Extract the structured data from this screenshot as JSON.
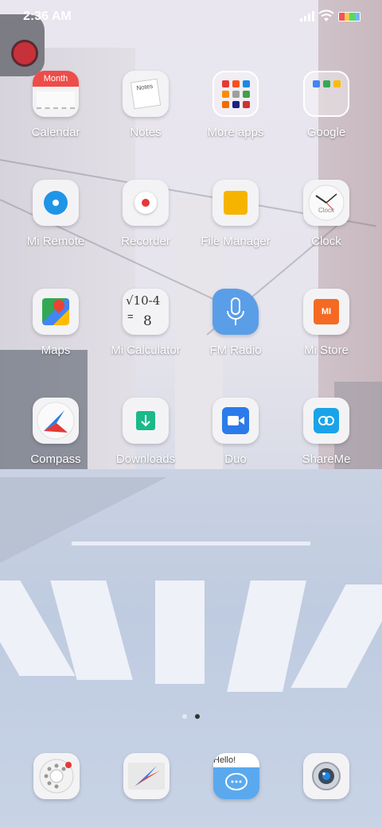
{
  "status_bar": {
    "time": "2:36 AM",
    "icons": [
      "signal-icon",
      "wifi-icon",
      "battery-icon"
    ]
  },
  "apps": [
    {
      "label": "Calendar",
      "icon": "calendar-icon",
      "icon_text": "Month"
    },
    {
      "label": "Notes",
      "icon": "notes-icon",
      "icon_text": "Notes"
    },
    {
      "label": "More apps",
      "icon": "folder-icon"
    },
    {
      "label": "Google",
      "icon": "folder-icon"
    },
    {
      "label": "Mi Remote",
      "icon": "remote-icon"
    },
    {
      "label": "Recorder",
      "icon": "recorder-icon"
    },
    {
      "label": "File Manager",
      "icon": "file-manager-icon"
    },
    {
      "label": "Clock",
      "icon": "clock-icon",
      "icon_text": "Clock"
    },
    {
      "label": "Maps",
      "icon": "maps-icon"
    },
    {
      "label": "Mi Calculator",
      "icon": "calculator-icon",
      "icon_text_top": "√10-4",
      "icon_text_bottom": "8",
      "icon_text_eq": "="
    },
    {
      "label": "FM Radio",
      "icon": "microphone-icon"
    },
    {
      "label": "Mi Store",
      "icon": "mi-store-icon",
      "icon_text": "MI"
    },
    {
      "label": "Compass",
      "icon": "compass-icon"
    },
    {
      "label": "Downloads",
      "icon": "download-icon"
    },
    {
      "label": "Duo",
      "icon": "video-camera-icon"
    },
    {
      "label": "ShareMe",
      "icon": "shareme-icon"
    }
  ],
  "dock": [
    {
      "name": "phone-dialer-icon"
    },
    {
      "name": "browser-compass-icon"
    },
    {
      "name": "messages-icon",
      "icon_text": "Hello!"
    },
    {
      "name": "camera-icon"
    }
  ],
  "page_indicator": {
    "pages": 2,
    "current": 2
  },
  "colors": {
    "calendar_red": "#ee4c49",
    "recorder_red": "#e5393a",
    "file_manager_yellow": "#f6b400",
    "mi_orange": "#f56a23",
    "duo_blue": "#2b7bea",
    "shareme_blue": "#1aa3e8",
    "downloads_green": "#1bb98a",
    "remote_blue": "#1f95e6",
    "radio_blue": "#5a9ee8"
  }
}
